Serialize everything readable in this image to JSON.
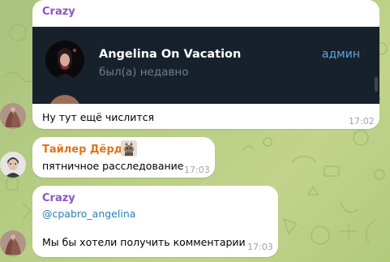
{
  "colors": {
    "background": "#b4ca83",
    "bubble": "#ffffff",
    "embed_bg": "#17212b",
    "sender_crazy": "#8c55c6",
    "sender_tyler": "#e0731b",
    "link": "#2b7fb8",
    "time": "#a3a3a3",
    "admin": "#5fa6e0",
    "embed_status": "#6d7f8f"
  },
  "messages": [
    {
      "sender": "Crazy",
      "forwarded_member": {
        "name": "Angelina On Vacation",
        "status": "был(а) недавно",
        "role": "админ"
      },
      "text": "Ну тут ещё числится",
      "time": "17:02"
    },
    {
      "sender": "Тайлер Дёрден",
      "text": "пятничное расследование",
      "time": "17:03"
    },
    {
      "sender": "Crazy",
      "mention": "@cpabro_angelina",
      "text": "Мы бы хотели получить комментарии",
      "time": "17:03"
    }
  ],
  "icons": {
    "sender_badge": "cat-sticker-icon",
    "avatar_crazy": "user-avatar-photo",
    "avatar_tyler": "user-avatar-photo",
    "embed_avatar": "member-avatar-photo"
  }
}
